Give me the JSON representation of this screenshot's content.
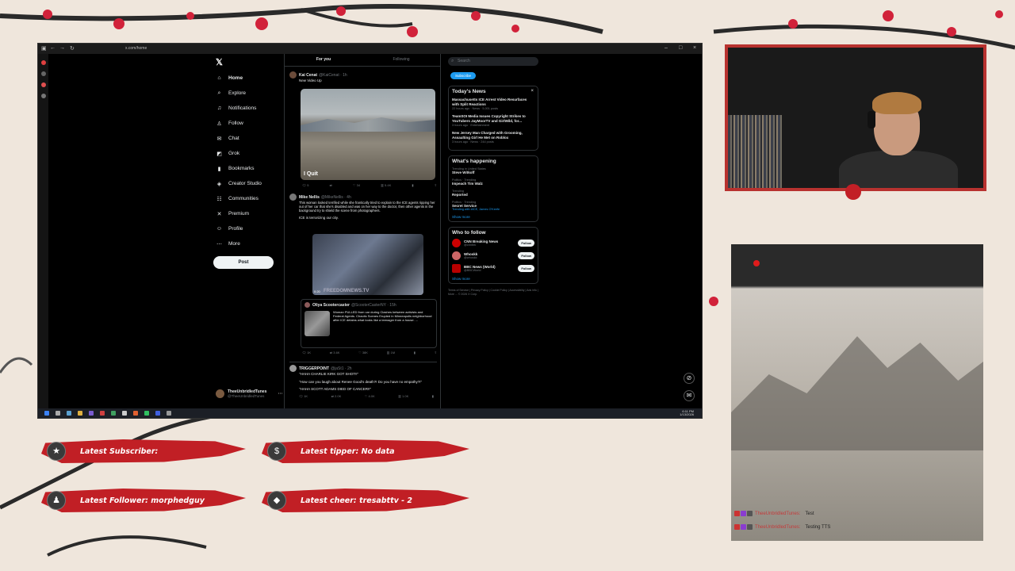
{
  "browser": {
    "url": "x.com/home",
    "taskbar_time": "6:11 PM",
    "taskbar_date": "1/13/2026"
  },
  "nav": {
    "items": [
      {
        "label": "Home",
        "icon": "home-icon"
      },
      {
        "label": "Explore",
        "icon": "search-icon"
      },
      {
        "label": "Notifications",
        "icon": "bell-icon"
      },
      {
        "label": "Follow",
        "icon": "person-icon"
      },
      {
        "label": "Chat",
        "icon": "chat-icon"
      },
      {
        "label": "Grok",
        "icon": "grok-icon"
      },
      {
        "label": "Bookmarks",
        "icon": "bookmark-icon"
      },
      {
        "label": "Creator Studio",
        "icon": "studio-icon"
      },
      {
        "label": "Communities",
        "icon": "communities-icon"
      },
      {
        "label": "Premium",
        "icon": "x-icon"
      },
      {
        "label": "Profile",
        "icon": "profile-icon"
      },
      {
        "label": "More",
        "icon": "more-icon"
      }
    ],
    "post_label": "Post",
    "account_name": "TheeUnbridledTunes",
    "account_handle": "@TheeUnbridledTunes"
  },
  "feed": {
    "tabs": [
      "For you",
      "Following"
    ],
    "tweet1": {
      "name": "Kai Cenat",
      "handle": "@KaiCenat · 1h",
      "text": "New Video Up",
      "media_caption": "I Quit",
      "actions": [
        "5",
        "",
        "34",
        "5.4K",
        "",
        ""
      ]
    },
    "tweet2": {
      "name": "Mike Nellis",
      "handle": "@MikeNellis · 4h",
      "text": "This woman looked terrified while she frantically tried to explain to the ICE agents ripping her out of her car that she's disabled and was on her way to the doctor, then other agents in the background try to shield the scene from photographers.",
      "text2": "ICE is terrorizing our city.",
      "media_watermark": "FREEDOMNEWS.TV",
      "media_time": "0:20"
    },
    "quote": {
      "name": "Oliya Scootercaster",
      "handle": "@ScooterCasterNY · 15h",
      "text": "Woman PULLED from car during Clashes between activists and Federal Agents. Chaotic Scenes Erupted in Minneapolis neighborhood after ICE detains what looks like a teenager from a house. ...",
      "actions": [
        "1K",
        "3.6K",
        "",
        "38K",
        "1M",
        ""
      ]
    },
    "tweet3": {
      "name": "TRIGGERPOINT",
      "handle": "@jaSt1 · 2h",
      "line1": "\"HAHA CHARLIE KIRK GOT SHOT!!\"",
      "line2": "\"How can you laugh about Renee Good's death?! Do you have no empathy?!\"",
      "line3": "\"HAHA SCOTT ADAMS DIED OF CANCER!!\"",
      "actions": [
        "1K",
        "2.0K",
        "",
        "4.0K",
        "1.0K",
        ""
      ]
    }
  },
  "right": {
    "search_placeholder": "Search",
    "subscribe_label": "Subscribe",
    "news_title": "Today's News",
    "news": [
      {
        "title": "Massachusetts ICE Arrest Video Resurfaces with Split Reactions",
        "meta": "22 hours ago · News · 5,001 posts"
      },
      {
        "title": "TeamSOI Media Issues Copyright Strikes to YouTubers JayMoorTV and GirlWild, for...",
        "meta": "3 hours ago · Entertainment"
      },
      {
        "title": "New Jersey Man Charged with Grooming, Assaulting Girl He Met on Roblox",
        "meta": "3 hours ago · News · 244 posts"
      }
    ],
    "happening_title": "What's happening",
    "trends": [
      {
        "meta": "Trending in United States",
        "title": "Steve Witkoff"
      },
      {
        "meta": "Politics · Trending",
        "title": "Impeach Tim Walz"
      },
      {
        "meta": "Trending",
        "title": "Reported"
      },
      {
        "meta": "Politics · Trending",
        "title": "Secret Service"
      }
    ],
    "trend_extra": "Trending with #ICE, James O'Keefe",
    "show_more": "Show more",
    "follow_title": "Who to follow",
    "follows": [
      {
        "name": "CNN Breaking News",
        "handle": "@cnnbrk",
        "button": "Follow"
      },
      {
        "name": "Whoskk",
        "handle": "@whoskk",
        "button": "Follow"
      },
      {
        "name": "BBC News (World)",
        "handle": "@BBCWorld",
        "button": "Follow"
      }
    ],
    "footer": "Terms of Service | Privacy Policy | Cookie Policy | Accessibility | Ads info | More ... © 2026 X Corp."
  },
  "chat": {
    "messages": [
      {
        "user": "TheeUnbridledTunes:",
        "message": "Test"
      },
      {
        "user": "TheeUnbridledTunes:",
        "message": "Testing TTS"
      }
    ]
  },
  "alerts": {
    "subscriber": "Latest Subscriber:",
    "tipper": "Latest tipper: No data",
    "follower": "Latest Follower: morphedguy",
    "cheer": "Latest cheer: tresabttv - 2"
  },
  "colors": {
    "accent": "#1d9bf0",
    "alert_red": "#c11f25",
    "background": "#efe6dc"
  }
}
